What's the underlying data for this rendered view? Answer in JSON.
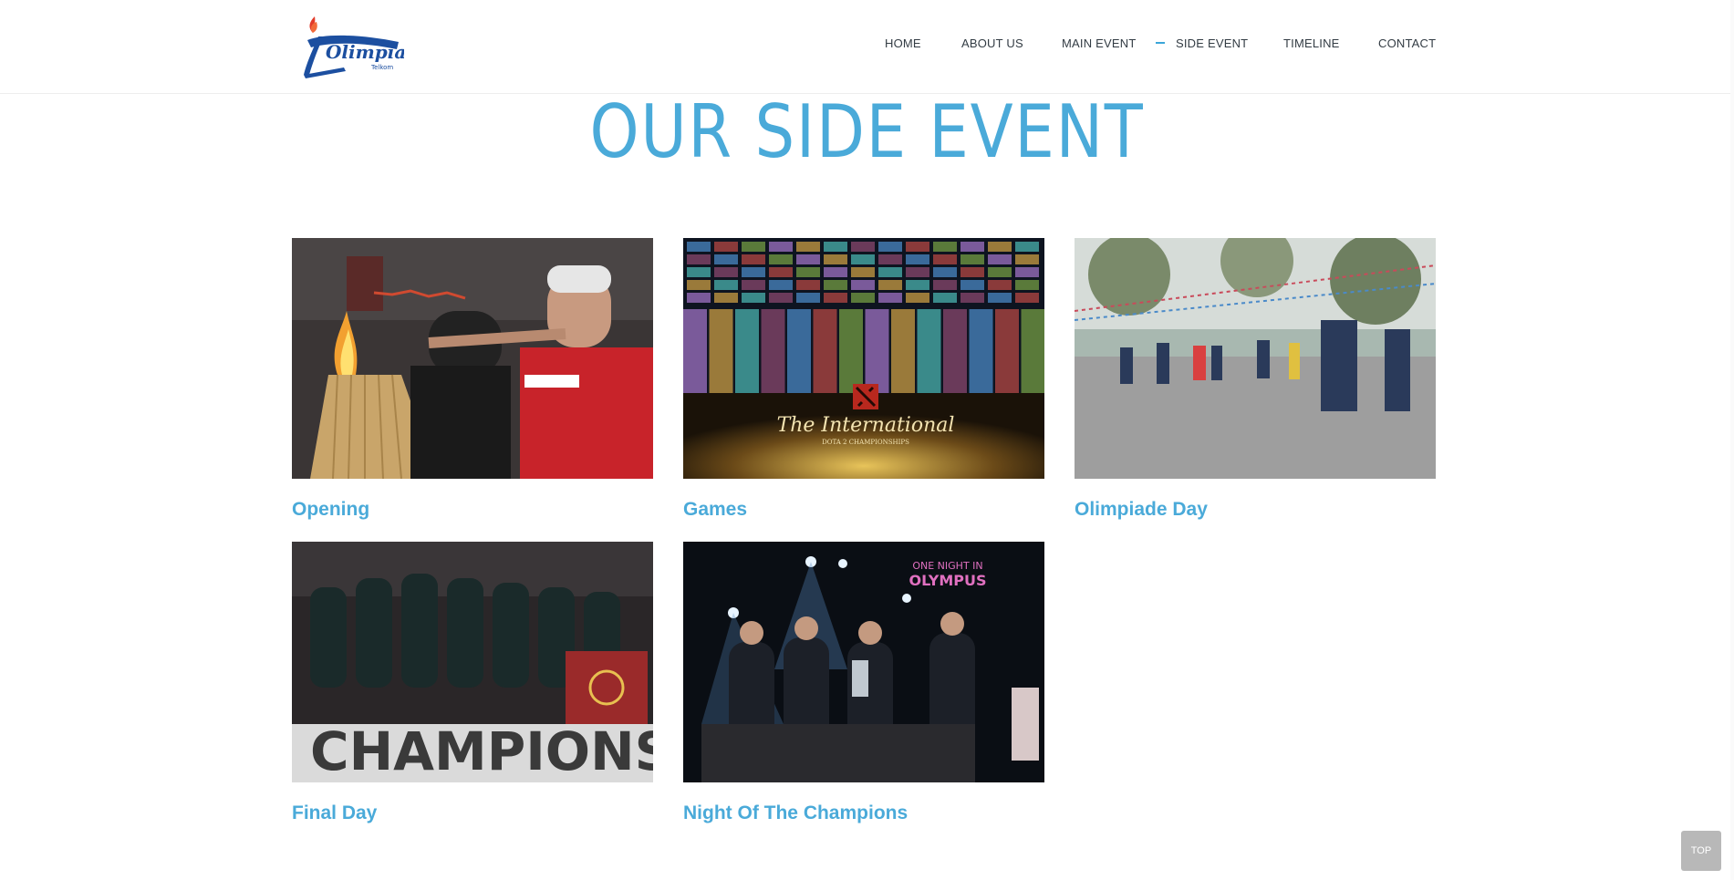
{
  "header": {
    "logo_alt": "Olimpiade Telkom logo",
    "nav": [
      {
        "label": "HOME",
        "active": false
      },
      {
        "label": "ABOUT US",
        "active": false
      },
      {
        "label": "MAIN EVENT",
        "active": false
      },
      {
        "label": "SIDE EVENT",
        "active": true
      },
      {
        "label": "TIMELINE",
        "active": false
      },
      {
        "label": "CONTACT",
        "active": false
      }
    ]
  },
  "page": {
    "title": "OUR SIDE EVENT"
  },
  "events": [
    {
      "label": "Opening",
      "image": "torch-lighting-photo"
    },
    {
      "label": "Games",
      "image": "dota2-international-banner"
    },
    {
      "label": "Olimpiade Day",
      "image": "outdoor-dance-photo"
    },
    {
      "label": "Final Day",
      "image": "champions-team-photo"
    },
    {
      "label": "Night Of The Champions",
      "image": "stage-winners-photo"
    }
  ],
  "top_button": {
    "label": "TOP"
  },
  "colors": {
    "accent": "#4aaad9",
    "nav_text": "#333c44",
    "top_button_bg": "#b8b8b8"
  }
}
